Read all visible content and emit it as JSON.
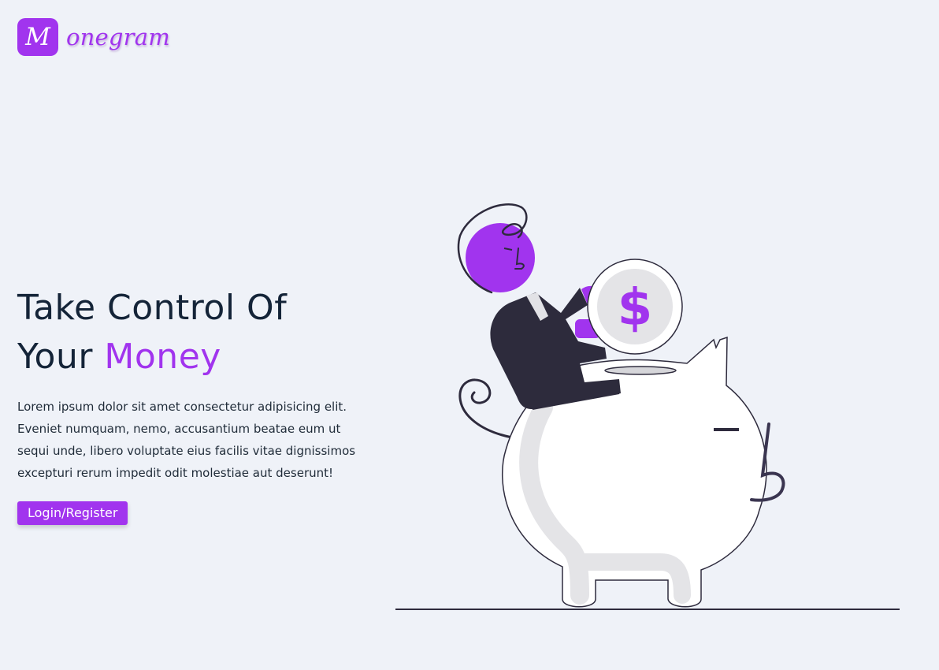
{
  "brand": {
    "logo_letter": "M",
    "logo_word": "onegram",
    "accent_color": "#a134ee"
  },
  "hero": {
    "title_line1": "Take Control Of",
    "title_line2_prefix": "Your ",
    "title_line2_accent": "Money",
    "body": "Lorem ipsum dolor sit amet consectetur adipisicing elit. Eveniet numquam, nemo, accusantium beatae eum ut sequi unde, libero voluptate eius facilis vitae dignissimos excepturi rerum impedit odit molestiae aut deserunt!",
    "cta_label": "Login/Register"
  },
  "illustration": {
    "coin_symbol": "$",
    "icon": "person-with-piggy-bank-illustration"
  }
}
